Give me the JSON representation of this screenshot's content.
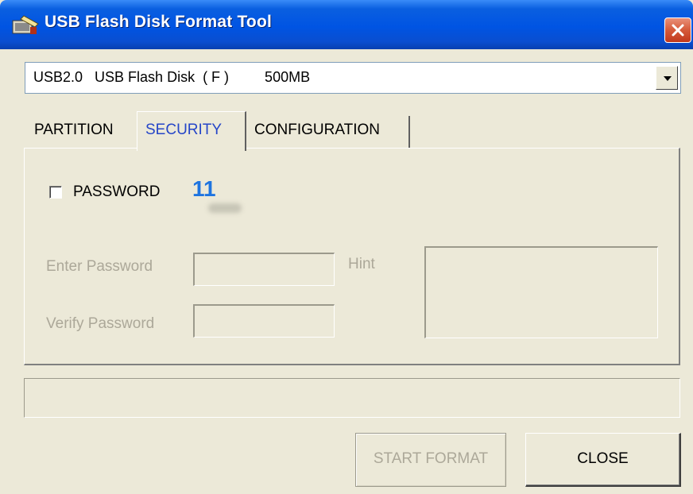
{
  "window": {
    "title": "USB Flash Disk Format Tool",
    "icon": "usb-tool-icon"
  },
  "device_select": {
    "value": "USB2.0   USB Flash Disk  ( F )         500MB"
  },
  "tabs": [
    {
      "label": "PARTITION",
      "active": false
    },
    {
      "label": "SECURITY",
      "active": true
    },
    {
      "label": "CONFIGURATION",
      "active": false
    }
  ],
  "security": {
    "password_checkbox": {
      "label": "PASSWORD",
      "checked": false
    },
    "annotation": "11",
    "enter_password_label": "Enter Password",
    "verify_password_label": "Verify Password",
    "hint_label": "Hint"
  },
  "buttons": {
    "start_format": "START FORMAT",
    "close": "CLOSE"
  },
  "colors": {
    "titlebar": "#0054e3",
    "window_bg": "#ece9d8",
    "active_tab_text": "#2646c8",
    "disabled_text": "#aca899",
    "annotation": "#1e74e0",
    "close_button": "#d55a3a"
  }
}
